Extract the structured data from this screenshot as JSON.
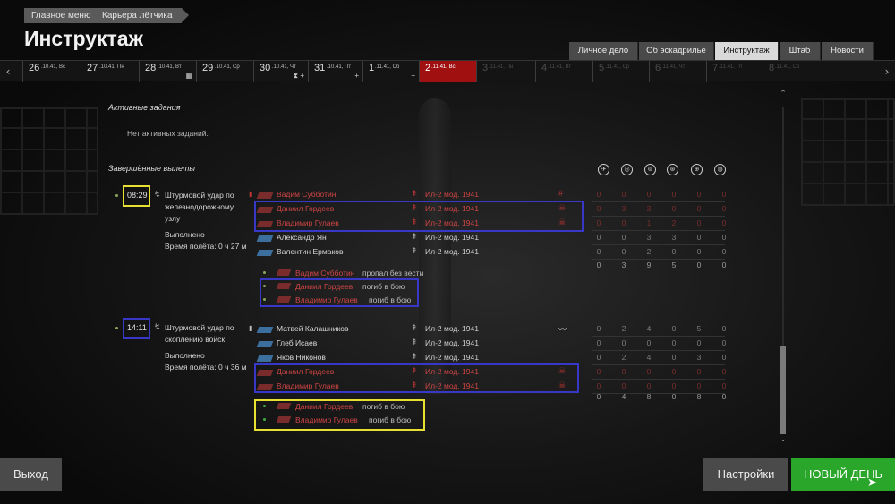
{
  "breadcrumb": [
    "Главное меню",
    "Карьера лётчика"
  ],
  "title": "Инструктаж",
  "tabs": [
    {
      "label": "Личное дело"
    },
    {
      "label": "Об эскадрилье"
    },
    {
      "label": "Инструктаж",
      "active": true
    },
    {
      "label": "Штаб"
    },
    {
      "label": "Новости"
    }
  ],
  "timeline": {
    "days": [
      {
        "num": "26",
        "sub": ".10.41, Вс",
        "icon": ""
      },
      {
        "num": "27",
        "sub": ".10.41, Пн",
        "icon": ""
      },
      {
        "num": "28",
        "sub": ".10.41, Вт",
        "icon": "▦"
      },
      {
        "num": "29",
        "sub": ".10.41, Ср",
        "icon": ""
      },
      {
        "num": "30",
        "sub": ".10.41, Чт",
        "icon": "⧗ +"
      },
      {
        "num": "31",
        "sub": ".10.41, Пт",
        "icon": "+"
      },
      {
        "num": "1",
        "sub": ".11.41, Сб",
        "icon": "+"
      },
      {
        "num": "2",
        "sub": ".11.41, Вс",
        "icon": "",
        "current": true
      },
      {
        "num": "3",
        "sub": ".11.41, Пн",
        "icon": "",
        "future": true
      },
      {
        "num": "4",
        "sub": ".11.41, Вт",
        "icon": "",
        "future": true
      },
      {
        "num": "5",
        "sub": ".11.41, Ср",
        "icon": "",
        "future": true
      },
      {
        "num": "6",
        "sub": ".11.41, Чт",
        "icon": "",
        "future": true
      },
      {
        "num": "7",
        "sub": ".11.41, Пт",
        "icon": "",
        "future": true
      },
      {
        "num": "8",
        "sub": ".11.41, Сб",
        "icon": "",
        "future": true
      }
    ]
  },
  "active_tasks": {
    "header": "Активные задания",
    "empty": "Нет активных заданий."
  },
  "completed": {
    "header": "Завершённые вылеты"
  },
  "stat_icons": [
    "plane-kill-icon",
    "ground-target-icon",
    "armor-target-icon",
    "vehicle-target-icon",
    "artillery-target-icon",
    "aa-target-icon"
  ],
  "sorties": [
    {
      "time": "08:29",
      "mission": "Штурмовой удар по железнодорожному узлу",
      "status": "Выполнено",
      "flight_time": "Время полёта: 0 ч 27 м",
      "pilots": [
        {
          "name": "Вадим Субботин",
          "plane": "Ил-2 мод. 1941",
          "red": true,
          "mark": "#",
          "stats": [
            "0",
            "0",
            "0",
            "0",
            "0",
            "0"
          ]
        },
        {
          "name": "Даниил Гордеев",
          "plane": "Ил-2 мод. 1941",
          "red": true,
          "mark": "☠",
          "stats": [
            "0",
            "3",
            "3",
            "0",
            "0",
            "0"
          ]
        },
        {
          "name": "Владимир Гулаев",
          "plane": "Ил-2 мод. 1941",
          "red": true,
          "mark": "☠",
          "stats": [
            "0",
            "0",
            "1",
            "2",
            "0",
            "0"
          ]
        },
        {
          "name": "Александр Ян",
          "plane": "Ил-2 мод. 1941",
          "red": false,
          "mark": "",
          "stats": [
            "0",
            "0",
            "3",
            "3",
            "0",
            "0"
          ]
        },
        {
          "name": "Валентин Ермаков",
          "plane": "Ил-2 мод. 1941",
          "red": false,
          "mark": "",
          "stats": [
            "0",
            "0",
            "2",
            "0",
            "0",
            "0"
          ]
        }
      ],
      "totals": [
        "0",
        "3",
        "9",
        "5",
        "0",
        "0"
      ],
      "casualties": [
        {
          "name": "Вадим Субботин",
          "status": "пропал без вести"
        },
        {
          "name": "Даниил Гордеев",
          "status": "погиб в бою"
        },
        {
          "name": "Владимир Гулаев",
          "status": "погиб в бою"
        }
      ]
    },
    {
      "time": "14:11",
      "mission": "Штурмовой удар по скоплению войск",
      "status": "Выполнено",
      "flight_time": "Время полёта: 0 ч 36 м",
      "pilots": [
        {
          "name": "Матвей Калашников",
          "plane": "Ил-2 мод. 1941",
          "red": false,
          "mark": "〰",
          "stats": [
            "0",
            "2",
            "4",
            "0",
            "5",
            "0"
          ]
        },
        {
          "name": "Глеб Исаев",
          "plane": "Ил-2 мод. 1941",
          "red": false,
          "mark": "",
          "stats": [
            "0",
            "0",
            "0",
            "0",
            "0",
            "0"
          ]
        },
        {
          "name": "Яков Никонов",
          "plane": "Ил-2 мод. 1941",
          "red": false,
          "mark": "",
          "stats": [
            "0",
            "2",
            "4",
            "0",
            "3",
            "0"
          ]
        },
        {
          "name": "Даниил Гордеев",
          "plane": "Ил-2 мод. 1941",
          "red": true,
          "mark": "☠",
          "stats": [
            "0",
            "0",
            "0",
            "0",
            "0",
            "0"
          ]
        },
        {
          "name": "Владимир Гулаев",
          "plane": "Ил-2 мод. 1941",
          "red": true,
          "mark": "☠",
          "stats": [
            "0",
            "0",
            "0",
            "0",
            "0",
            "0"
          ]
        }
      ],
      "totals": [
        "0",
        "4",
        "8",
        "0",
        "8",
        "0"
      ],
      "casualties": [
        {
          "name": "Даниил Гордеев",
          "status": "погиб в бою"
        },
        {
          "name": "Владимир Гулаев",
          "status": "погиб в бою"
        }
      ]
    }
  ],
  "buttons": {
    "exit": "Выход",
    "settings": "Настройки",
    "new_day": "НОВЫЙ ДЕНЬ"
  },
  "colors": {
    "accent_green": "#2aa62a",
    "current_day_red": "#a01010",
    "casualty_red": "#d04545",
    "highlight_blue": "#3838c8",
    "highlight_yellow": "#e8e030"
  }
}
